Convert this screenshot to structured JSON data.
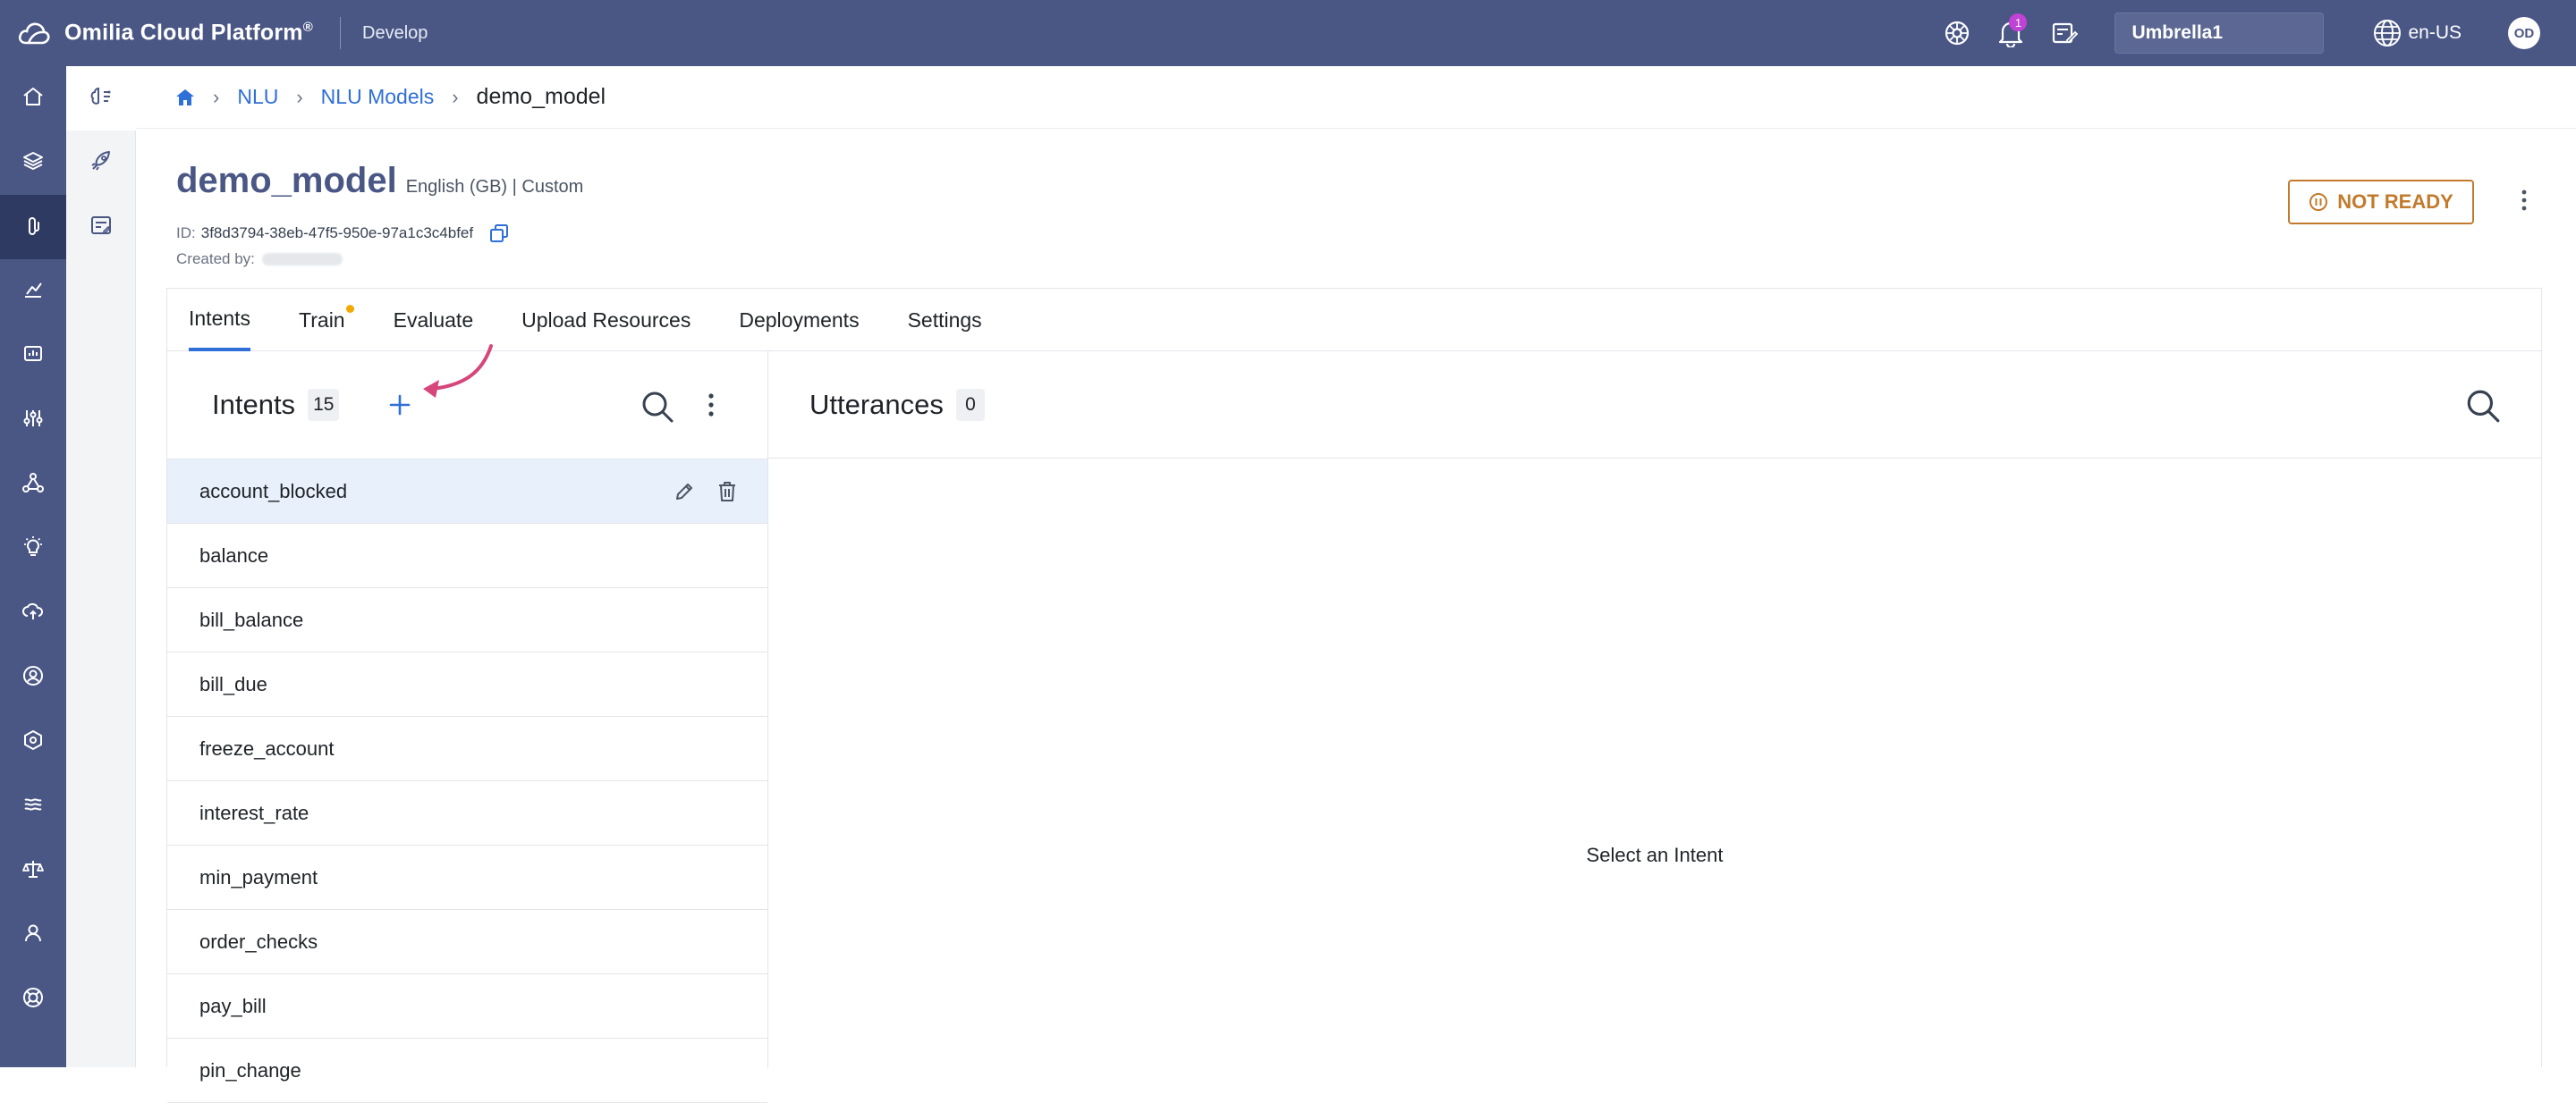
{
  "app": {
    "name": "Omilia Cloud Platform",
    "trademark": "®",
    "environment": "Develop"
  },
  "topbar": {
    "notification_count": "1",
    "tenant": "Umbrella1",
    "language": "en-US",
    "user_initials": "OD"
  },
  "breadcrumb": {
    "items": [
      "NLU",
      "NLU Models"
    ],
    "current": "demo_model"
  },
  "model": {
    "name": "demo_model",
    "meta": "English (GB) | Custom",
    "id_label": "ID:",
    "id_value": "3f8d3794-38eb-47f5-950e-97a1c3c4bfef",
    "created_label": "Created by:",
    "status": "NOT READY"
  },
  "tabs": [
    "Intents",
    "Train",
    "Evaluate",
    "Upload Resources",
    "Deployments",
    "Settings"
  ],
  "intents": {
    "title": "Intents",
    "count": "15",
    "items": [
      "account_blocked",
      "balance",
      "bill_balance",
      "bill_due",
      "freeze_account",
      "interest_rate",
      "min_payment",
      "order_checks",
      "pay_bill",
      "pin_change"
    ]
  },
  "utterances": {
    "title": "Utterances",
    "count": "0",
    "empty_message": "Select an Intent"
  },
  "colors": {
    "brand": "#4a5785",
    "accent": "#2e6fd8",
    "warning": "#c27a2c",
    "annotation": "#d6467a",
    "selected_row": "#e8f0fb"
  }
}
